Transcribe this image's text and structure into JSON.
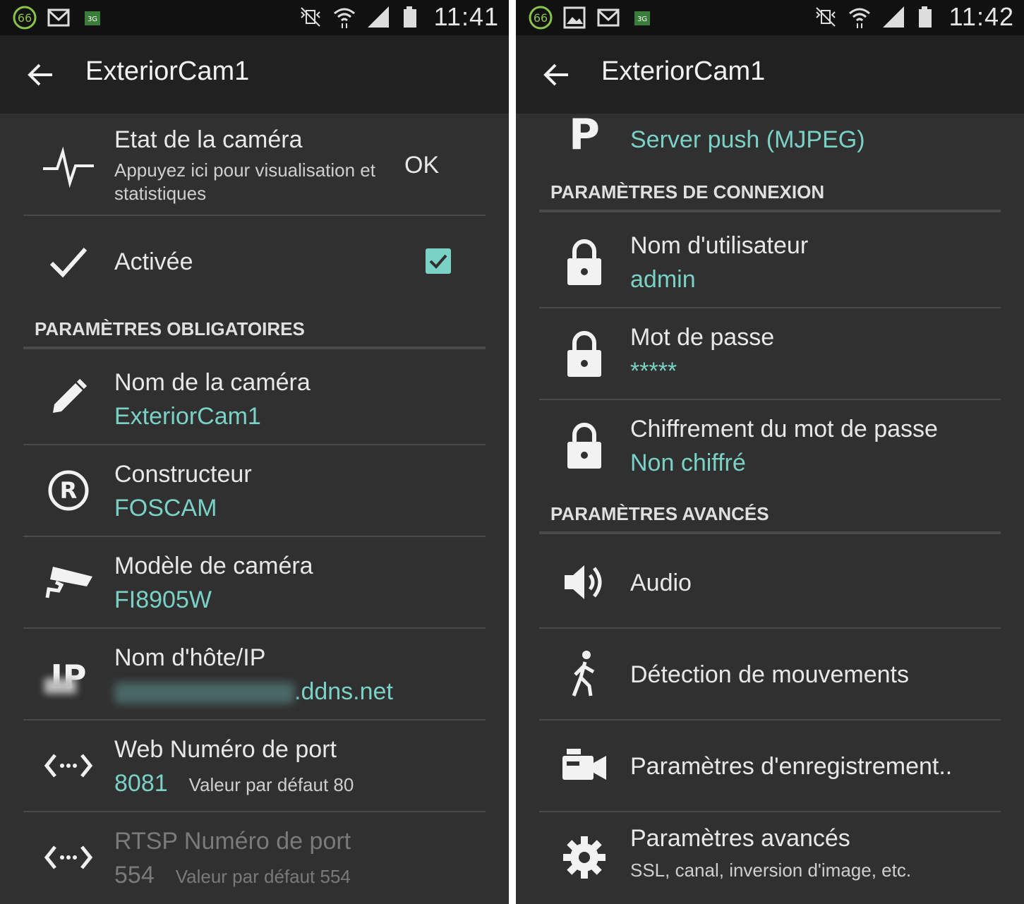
{
  "left": {
    "status": {
      "time": "11:41",
      "notif_badge": "66",
      "net": "3G"
    },
    "appbar": {
      "title": "ExteriorCam1"
    },
    "rows": {
      "etat": {
        "title": "Etat de la caméra",
        "summary": "Appuyez ici pour visualisation et statistiques",
        "status": "OK"
      },
      "activee": {
        "title": "Activée",
        "checked": true
      },
      "section_obligatoires": "PARAMÈTRES OBLIGATOIRES",
      "nom": {
        "title": "Nom de la caméra",
        "value": "ExteriorCam1"
      },
      "constructeur": {
        "title": "Constructeur",
        "value": "FOSCAM"
      },
      "modele": {
        "title": "Modèle de caméra",
        "value": "FI8905W"
      },
      "hote": {
        "title": "Nom d'hôte/IP",
        "value_suffix": ".ddns.net",
        "icon_text": "IP"
      },
      "web_port": {
        "title": "Web Numéro de port",
        "value": "8081",
        "hint": "Valeur par défaut 80"
      },
      "rtsp_port": {
        "title": "RTSP Numéro de port",
        "value": "554",
        "hint": "Valeur par défaut 554"
      }
    }
  },
  "right": {
    "status": {
      "time": "11:42",
      "notif_badge": "66",
      "net": "3G"
    },
    "appbar": {
      "title": "ExteriorCam1"
    },
    "rows": {
      "protocole": {
        "value": "Server push (MJPEG)",
        "icon_text": "P"
      },
      "section_connexion": "PARAMÈTRES DE CONNEXION",
      "utilisateur": {
        "title": "Nom d'utilisateur",
        "value": "admin"
      },
      "motdepasse": {
        "title": "Mot de passe",
        "value": "*****"
      },
      "chiffrement": {
        "title": "Chiffrement du mot de passe",
        "value": "Non chiffré"
      },
      "section_avances": "PARAMÈTRES AVANCÉS",
      "audio": {
        "title": "Audio"
      },
      "detection": {
        "title": "Détection de mouvements"
      },
      "enregistrement": {
        "title": "Paramètres d'enregistrement.."
      },
      "avances": {
        "title": "Paramètres avancés",
        "summary": "SSL, canal, inversion d'image, etc."
      }
    }
  },
  "colors": {
    "accent": "#7ad1c6",
    "background": "#303030",
    "appbar": "#212121",
    "statusbar": "#111111",
    "divider": "#4a4a4a"
  },
  "icons": [
    "pulse-icon",
    "check-icon",
    "pencil-icon",
    "registered-icon",
    "cctv-camera-icon",
    "ip-icon",
    "code-arrows-icon",
    "p-icon",
    "lock-icon",
    "speaker-icon",
    "walking-icon",
    "video-camera-icon",
    "gear-icon",
    "back-arrow-icon"
  ]
}
